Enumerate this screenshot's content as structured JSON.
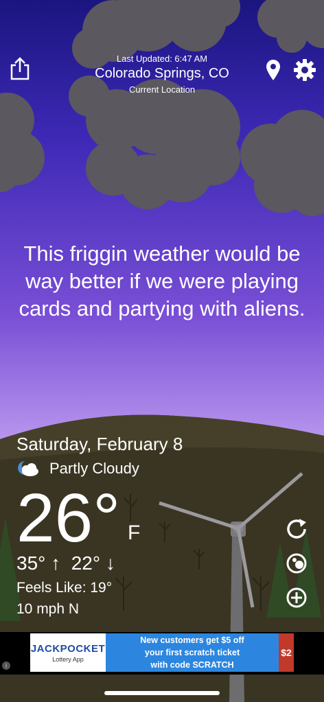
{
  "header": {
    "last_updated": "Last Updated: 6:47 AM",
    "city": "Colorado Springs, CO",
    "location_label": "Current Location"
  },
  "icons": {
    "share": "share-icon",
    "location": "location-pin-icon",
    "settings": "gear-icon",
    "refresh": "refresh-icon",
    "radar": "radar-icon",
    "add": "plus-circle-icon",
    "condition": "partly-cloudy-night-icon"
  },
  "quote": "This friggin weather would be way better if we were playing cards and partying with aliens.",
  "weather": {
    "date": "Saturday, February 8",
    "condition": "Partly Cloudy",
    "temperature": "26°",
    "unit": "F",
    "high": "35°",
    "low": "22°",
    "feels_like": "Feels Like: 19°",
    "wind": "10 mph N"
  },
  "ad": {
    "brand": "JACKPOCKET",
    "brand_sub": "Lottery App",
    "line1": "New customers get $5 off",
    "line2": "your first scratch ticket",
    "line3": "with code SCRATCH",
    "badge": "$2"
  },
  "colors": {
    "sky_top": "#1a157f",
    "sky_bottom": "#b593ec",
    "hill": "#3a3522",
    "ad_blue": "#2c86df"
  }
}
